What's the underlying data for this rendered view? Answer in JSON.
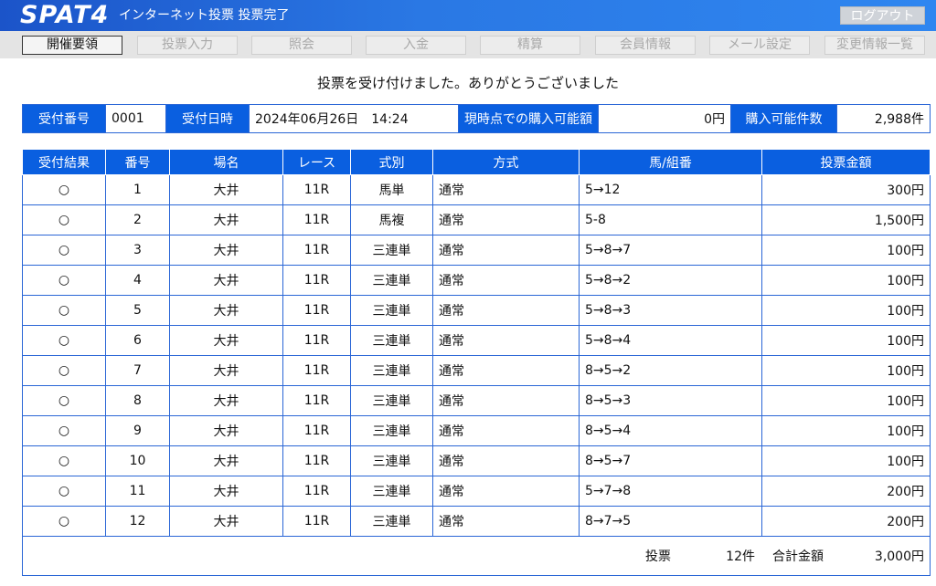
{
  "header": {
    "logo": "SPAT4",
    "title": "インターネット投票 投票完了",
    "logout_label": "ログアウト"
  },
  "nav": {
    "items": [
      {
        "label": "開催要領",
        "active": true
      },
      {
        "label": "投票入力",
        "active": false
      },
      {
        "label": "照会",
        "active": false
      },
      {
        "label": "入金",
        "active": false
      },
      {
        "label": "精算",
        "active": false
      },
      {
        "label": "会員情報",
        "active": false
      },
      {
        "label": "メール設定",
        "active": false
      },
      {
        "label": "変更情報一覧",
        "active": false
      }
    ]
  },
  "message": "投票を受け付けました。ありがとうございました",
  "info": {
    "receipt_no_label": "受付番号",
    "receipt_no": "0001",
    "receipt_time_label": "受付日時",
    "receipt_time": "2024年06月26日　14:24",
    "balance_label": "現時点での購入可能額",
    "balance": "0円",
    "count_label": "購入可能件数",
    "count": "2,988件"
  },
  "table": {
    "headers": [
      "受付結果",
      "番号",
      "場名",
      "レース",
      "式別",
      "方式",
      "馬/組番",
      "投票金額"
    ],
    "rows": [
      {
        "result": "○",
        "no": "1",
        "venue": "大井",
        "race": "11R",
        "type": "馬単",
        "method": "通常",
        "combo": "5→12",
        "amount": "300円"
      },
      {
        "result": "○",
        "no": "2",
        "venue": "大井",
        "race": "11R",
        "type": "馬複",
        "method": "通常",
        "combo": "5-8",
        "amount": "1,500円"
      },
      {
        "result": "○",
        "no": "3",
        "venue": "大井",
        "race": "11R",
        "type": "三連単",
        "method": "通常",
        "combo": "5→8→7",
        "amount": "100円"
      },
      {
        "result": "○",
        "no": "4",
        "venue": "大井",
        "race": "11R",
        "type": "三連単",
        "method": "通常",
        "combo": "5→8→2",
        "amount": "100円"
      },
      {
        "result": "○",
        "no": "5",
        "venue": "大井",
        "race": "11R",
        "type": "三連単",
        "method": "通常",
        "combo": "5→8→3",
        "amount": "100円"
      },
      {
        "result": "○",
        "no": "6",
        "venue": "大井",
        "race": "11R",
        "type": "三連単",
        "method": "通常",
        "combo": "5→8→4",
        "amount": "100円"
      },
      {
        "result": "○",
        "no": "7",
        "venue": "大井",
        "race": "11R",
        "type": "三連単",
        "method": "通常",
        "combo": "8→5→2",
        "amount": "100円"
      },
      {
        "result": "○",
        "no": "8",
        "venue": "大井",
        "race": "11R",
        "type": "三連単",
        "method": "通常",
        "combo": "8→5→3",
        "amount": "100円"
      },
      {
        "result": "○",
        "no": "9",
        "venue": "大井",
        "race": "11R",
        "type": "三連単",
        "method": "通常",
        "combo": "8→5→4",
        "amount": "100円"
      },
      {
        "result": "○",
        "no": "10",
        "venue": "大井",
        "race": "11R",
        "type": "三連単",
        "method": "通常",
        "combo": "8→5→7",
        "amount": "100円"
      },
      {
        "result": "○",
        "no": "11",
        "venue": "大井",
        "race": "11R",
        "type": "三連単",
        "method": "通常",
        "combo": "5→7→8",
        "amount": "200円"
      },
      {
        "result": "○",
        "no": "12",
        "venue": "大井",
        "race": "11R",
        "type": "三連単",
        "method": "通常",
        "combo": "8→7→5",
        "amount": "200円"
      }
    ],
    "footer": {
      "votes_label": "投票",
      "votes_count": "12件",
      "total_label": "合計金額",
      "total_amount": "3,000円"
    }
  },
  "colors": {
    "header_blue": "#0a5fe0",
    "border_blue": "#2a66d6",
    "nav_bg": "#e4e4e4"
  }
}
